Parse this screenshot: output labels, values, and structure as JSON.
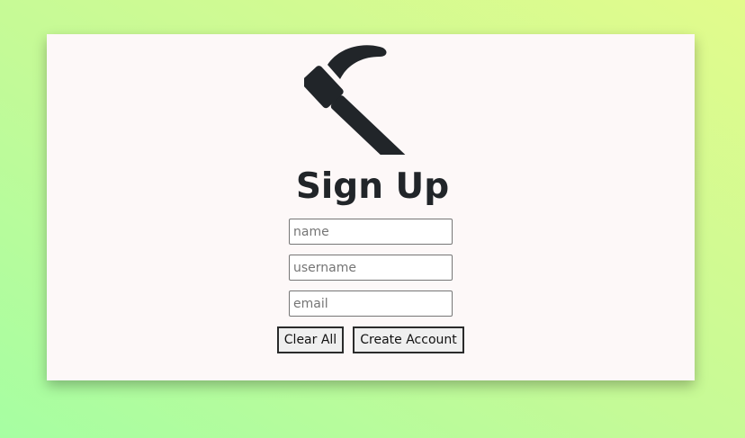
{
  "signup": {
    "title": "Sign Up",
    "logo_icon": "hammer-icon",
    "fields": {
      "name_placeholder": "name",
      "username_placeholder": "username",
      "email_placeholder": "email"
    },
    "buttons": {
      "clear_label": "Clear All",
      "create_label": "Create Account"
    }
  },
  "colors": {
    "background_gradient_start": "#a6fea2",
    "background_gradient_end": "#e2fb8c",
    "card_background": "#fdf8f8",
    "icon_and_title": "#212529"
  }
}
